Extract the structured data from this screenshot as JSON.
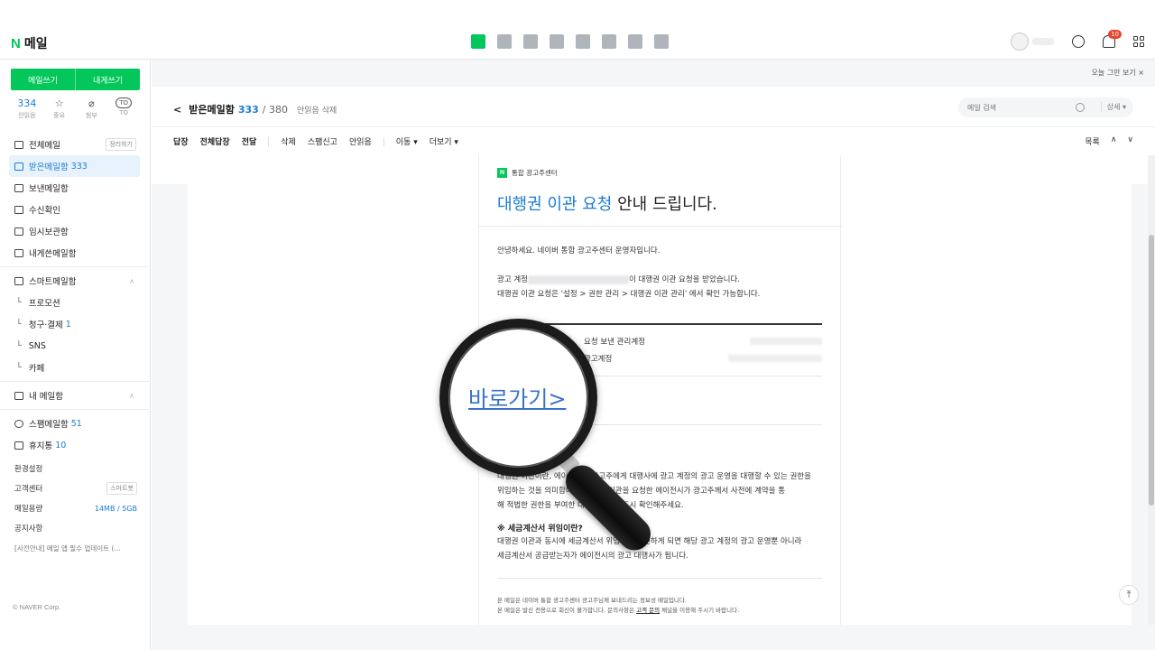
{
  "app": {
    "logo_letter": "N",
    "title": "메일"
  },
  "header": {
    "notif_count": "10",
    "notice": "오늘 그만 보기 ×"
  },
  "sidebar": {
    "compose": "메일쓰기",
    "to_me": "내게쓰기",
    "stats": [
      {
        "value": "334",
        "label": "안읽음"
      },
      {
        "value": "☆",
        "label": "중요"
      },
      {
        "value": "⌀",
        "label": "첨부"
      },
      {
        "value": "TO",
        "label": "TO"
      }
    ],
    "folders": [
      {
        "label": "전체메일",
        "tag": "정리하기"
      },
      {
        "label": "받은메일함",
        "count": "333"
      },
      {
        "label": "보낸메일함"
      },
      {
        "label": "수신확인"
      },
      {
        "label": "임시보관함"
      },
      {
        "label": "내게쓴메일함"
      }
    ],
    "smart": {
      "label": "스마트메일함",
      "items": [
        {
          "label": "프로모션"
        },
        {
          "label": "청구·결제",
          "count": "1"
        },
        {
          "label": "SNS"
        },
        {
          "label": "카페"
        }
      ]
    },
    "my_mailbox": "내 메일함",
    "spam": {
      "label": "스팸메일함",
      "count": "51"
    },
    "trash": {
      "label": "휴지통",
      "count": "10"
    },
    "settings": "환경설정",
    "support": {
      "label": "고객센터",
      "tag": "스마트봇"
    },
    "storage": {
      "label": "메일용량",
      "value": "14MB / 5GB"
    },
    "notice_title": "공지사항",
    "notice_text": "[사전안내] 메일 앱 필수 업데이트 (...",
    "copyright": "© NAVER Corp."
  },
  "mailbox": {
    "name": "받은메일함",
    "unread": "333",
    "total": "/ 380",
    "action": "안읽음 삭제"
  },
  "search": {
    "placeholder": "메일 검색",
    "detail": "상세 ▾"
  },
  "toolbar": {
    "reply": "답장",
    "reply_all": "전체답장",
    "forward": "전달",
    "delete": "삭제",
    "spam": "스팸신고",
    "unread": "안읽음",
    "move": "이동 ▾",
    "more": "더보기 ▾",
    "list": "목록",
    "up": "∧",
    "down": "∨"
  },
  "mail": {
    "sender": "통합 광고주센터",
    "headline_highlight": "대행권 이관 요청",
    "headline_rest": " 안내 드립니다.",
    "greeting": "안녕하세요. 네이버 통합 광고주센터 운영자입니다.",
    "line1_pre": "광고 계정",
    "line1_post": "이 대행권 이관 요청을 받았습니다.",
    "line2": "대행권 이관 요청은 '설정 > 권한 관리 > 대행권 이관 관리' 에서 확인 가능합니다.",
    "row1": "요청 보낸 관리계정",
    "row2": "광고계정",
    "link": "바로가기>",
    "section1_body_a": "대행권 이관이란, 에이전시가 광고주에게 대행사에 광고 계정의 광고 운영을 대행할 수 있는 권한을",
    "section1_body_b": "위임하는 것을 의미합니다. 대행권 이관을 요청한 에이전시가 광고주께서 사전에 계약을 통",
    "section1_body_c": "해 적법한 권한을 부여한 대행사인지 반드시 확인해주세요.",
    "section2_title": "※ 세금계산서 위임이란?",
    "section2_body_a": "대행권 이관과 동시에 세금계산서 위임까지 승인하게 되면 해당 광고 계정의 광고 운영뿐 아니라",
    "section2_body_b": "세금계산서 공급받는자가 에이전시의 광고 대행사가 됩니다.",
    "footer1": "본 메일은 네이버 통합 광고주센터 광고주님께 보내드리는 정보성 메일입니다.",
    "footer2_pre": "본 메일은 발신 전용으로 회신이 불가합니다. 문의사항은 ",
    "footer2_link": "고객 문의",
    "footer2_post": " 채널을 이용해 주시기 바랍니다."
  },
  "magnifier": {
    "text": "바로가기>"
  }
}
